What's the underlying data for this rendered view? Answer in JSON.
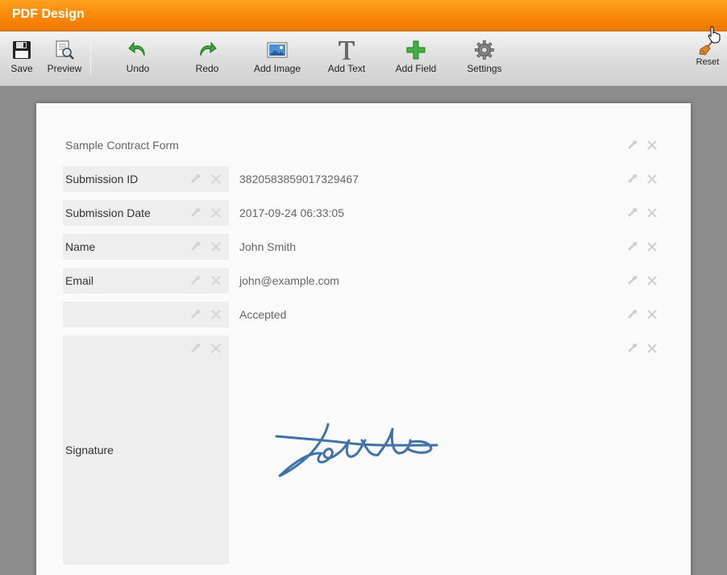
{
  "window": {
    "title": "PDF Design"
  },
  "toolbar": {
    "save": "Save",
    "preview": "Preview",
    "undo": "Undo",
    "redo": "Redo",
    "add_image": "Add Image",
    "add_text": "Add Text",
    "add_field": "Add Field",
    "settings": "Settings",
    "reset": "Reset"
  },
  "form": {
    "title": "Sample Contract Form",
    "rows": [
      {
        "label": "Submission ID",
        "value": "3820583859017329467"
      },
      {
        "label": "Submission Date",
        "value": "2017-09-24 06:33:05"
      },
      {
        "label": "Name",
        "value": "John Smith"
      },
      {
        "label": "Email",
        "value": "john@example.com"
      },
      {
        "label": "",
        "value": "Accepted"
      },
      {
        "label": "Signature",
        "value": ""
      }
    ]
  },
  "colors": {
    "accent": "#f98a0a",
    "signature": "#3f72a8"
  },
  "icons": [
    "floppy-disk-icon",
    "preview-icon",
    "undo-arrow-icon",
    "redo-arrow-icon",
    "image-icon",
    "text-t-icon",
    "plus-icon",
    "gear-icon",
    "broom-icon",
    "wrench-icon",
    "close-icon",
    "hand-cursor-icon"
  ]
}
